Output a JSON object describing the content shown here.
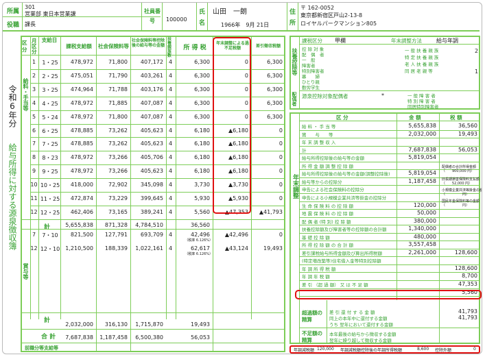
{
  "header": {
    "dept_label": "所属",
    "role_label": "役職",
    "dept_code": "301",
    "dept_name": "営業部 東日本営業課",
    "role": "課長",
    "emp_label": "社員番号",
    "emp_no": "100000",
    "name_label": "氏名",
    "name": "山田　一朗",
    "birth": "1966年　9月 21日",
    "addr_label": "住所",
    "zip": "〒 162-0052",
    "addr1": "東京都新宿区戸山2-13-8",
    "addr2": "ロイヤルパークマンション805"
  },
  "side_title": {
    "year": "令和6年分",
    "title": "給与所得に対する源泉徴収簿"
  },
  "columns": {
    "kubun": "区分",
    "month": "月区分",
    "payday": "支給日",
    "gross": "課税支給額",
    "social": "社会保険料等",
    "after_social": "社会保険料等控除後の給与等の金額",
    "dependents": "扶養親族数",
    "tax": "所 得 税",
    "adjust": "年末調整による過不足税額",
    "net": "差引徴収税額"
  },
  "salary_label": "給料・手当等",
  "bonus_label": "賞与等",
  "salary_rows": [
    {
      "m": "1",
      "d": "1・25",
      "gross": "478,972",
      "social": "71,800",
      "after": "407,172",
      "dep": "4",
      "tax": "6,300",
      "adj": "0",
      "net": "6,300"
    },
    {
      "m": "2",
      "d": "2・25",
      "gross": "475,051",
      "social": "71,790",
      "after": "403,261",
      "dep": "4",
      "tax": "6,300",
      "adj": "0",
      "net": "6,300"
    },
    {
      "m": "3",
      "d": "3・25",
      "gross": "474,964",
      "social": "71,788",
      "after": "403,176",
      "dep": "4",
      "tax": "6,300",
      "adj": "0",
      "net": "6,300"
    },
    {
      "m": "4",
      "d": "4・25",
      "gross": "478,972",
      "social": "71,885",
      "after": "407,087",
      "dep": "4",
      "tax": "6,300",
      "adj": "0",
      "net": "6,300"
    },
    {
      "m": "5",
      "d": "5・24",
      "gross": "478,972",
      "social": "71,800",
      "after": "407,087",
      "dep": "4",
      "tax": "6,300",
      "adj": "0",
      "net": "6,300"
    },
    {
      "m": "6",
      "d": "6・25",
      "gross": "478,885",
      "social": "73,262",
      "after": "405,623",
      "dep": "4",
      "tax": "6,180",
      "adj": "▲6,180",
      "net": "0"
    },
    {
      "m": "7",
      "d": "7・25",
      "gross": "478,885",
      "social": "73,262",
      "after": "405,623",
      "dep": "4",
      "tax": "6,180",
      "adj": "▲6,180",
      "net": "0"
    },
    {
      "m": "8",
      "d": "8・23",
      "gross": "478,972",
      "social": "73,266",
      "after": "405,706",
      "dep": "4",
      "tax": "6,180",
      "adj": "▲6,180",
      "net": "0"
    },
    {
      "m": "9",
      "d": "9・25",
      "gross": "478,972",
      "social": "73,266",
      "after": "405,623",
      "dep": "4",
      "tax": "6,180",
      "adj": "▲6,180",
      "net": "0"
    },
    {
      "m": "10",
      "d": "10・25",
      "gross": "418,000",
      "social": "72,902",
      "after": "345,098",
      "dep": "4",
      "tax": "3,730",
      "adj": "▲3,730",
      "net": "0"
    },
    {
      "m": "11",
      "d": "11・25",
      "gross": "472,874",
      "social": "73,229",
      "after": "399,645",
      "dep": "4",
      "tax": "5,930",
      "adj": "▲5,930",
      "net": "0"
    },
    {
      "m": "12",
      "d": "12・25",
      "gross": "462,406",
      "social": "73,165",
      "after": "389,241",
      "dep": "4",
      "tax": "5,560",
      "adj": "▲47,353",
      "net": "▲41,793"
    }
  ],
  "salary_total": {
    "label": "計",
    "gross": "5,655,838",
    "social": "871,328",
    "after": "4,784,510",
    "tax": "36,560"
  },
  "bonus_rows": [
    {
      "m": "7",
      "d": "7・10",
      "gross": "821,500",
      "social": "127,791",
      "after": "693,709",
      "dep": "4",
      "tax": "42,496",
      "rate": "（税率 6.126%）",
      "adj": "▲42,496",
      "net": "0"
    },
    {
      "m": "12",
      "d": "12・10",
      "gross": "1,210,500",
      "social": "188,339",
      "after": "1,022,161",
      "dep": "4",
      "tax": "62,617",
      "rate": "（税率 6.126%）",
      "adj": "▲43,124",
      "net": "19,493"
    }
  ],
  "bonus_total": {
    "label": "計",
    "gross": "2,032,000",
    "social": "316,130",
    "after": "1,715,870",
    "tax": "19,493"
  },
  "grand_total": {
    "label": "合 計",
    "gross": "7,687,838",
    "social": "1,187,458",
    "after": "6,500,380",
    "tax": "56,053"
  },
  "prev_job_label": "前職分等支給等",
  "right_top": {
    "kubun_label": "課税区分",
    "kubun_value": "甲欄",
    "method_label": "年末調整方法",
    "method_value": "給与年調",
    "dep_side": "扶養控除等",
    "items_left": [
      "控 除 対 象",
      "配　偶　者",
      "一　般",
      "障害者",
      "特別障害者",
      "寡　　婦",
      "ひとり親",
      "勤労学生"
    ],
    "items_right": [
      "一 般 扶 養 親 族",
      "特 定 扶 養 親 族",
      "老 人 扶 養 親 族",
      "同 居 老 親 等"
    ],
    "right_vals": [
      "2",
      "1"
    ],
    "spouse_label": "源泉控除対象配偶者",
    "spouse_mark": "*",
    "spouse_side": "配偶者",
    "spouse_items": [
      "一 般 障 害 者",
      "特 別 障 害 者",
      "同居特別障害者"
    ]
  },
  "year_end": {
    "side": "年末調整",
    "col_kubun": "区 分",
    "col_amount": "金 額",
    "col_tax": "税 額",
    "rows": [
      {
        "label": "給 料 ・ 手 当 等",
        "amount": "5,655,838",
        "tax": "36,560"
      },
      {
        "label": "賞　　与　　等",
        "amount": "2,032,000",
        "tax": "19,493"
      },
      {
        "label": "年 末 調 整 収 入",
        "amount": "",
        "tax": ""
      },
      {
        "label": "計",
        "amount": "7,687,838",
        "tax": "56,053"
      },
      {
        "label": "給与所得控除後の給与等の金額",
        "amount": "5,819,054",
        "tax": ""
      },
      {
        "label": "所 得 金 額 調 整 控 除 額",
        "amount": "",
        "tax": ""
      },
      {
        "label": "給与所得控除後の給与等の金額(調整控除後)",
        "amount": "5,819,054",
        "tax": ""
      },
      {
        "label": "給与等からの控除分",
        "amount": "1,187,458",
        "tax": ""
      },
      {
        "label": "申告による社会保険料の控除分",
        "amount": "",
        "tax": ""
      },
      {
        "label": "申告による小規模企業共済等掛金の控除分",
        "amount": "",
        "tax": ""
      },
      {
        "label": "生 命 保 険 料 の 控 除 額",
        "amount": "120,000",
        "tax": ""
      },
      {
        "label": "地 震 保 険 料 の 控 除 額",
        "amount": "50,000",
        "tax": ""
      },
      {
        "label": "配 偶 者 (特 別) 控 除 額",
        "amount": "380,000",
        "tax": ""
      },
      {
        "label": "扶養控除額及び障害者等の控除額の合計額",
        "amount": "1,340,000",
        "tax": ""
      },
      {
        "label": "基 礎 控 除 額",
        "amount": "480,000",
        "tax": ""
      },
      {
        "label": "所 得 控 除 額 の 合 計 額",
        "amount": "3,557,458",
        "tax": ""
      },
      {
        "label": "差引課税給与所得金額及び算出所得税額",
        "amount": "2,261,000",
        "tax": "128,600"
      },
      {
        "label": "(特定増改築等)住宅借入金等特別控除額",
        "amount": "",
        "tax": ""
      },
      {
        "label": "年 調 所 得 税 額",
        "amount": "",
        "tax": "128,600"
      },
      {
        "label": "年 調 年 税 額",
        "amount": "",
        "tax": "8,700"
      },
      {
        "label": "差 引 （超 過 額） 又 は 不 足 額",
        "amount": "",
        "tax": "47,353"
      },
      {
        "label": "",
        "amount": "",
        "tax": "5,560"
      }
    ],
    "side_notes": [
      {
        "label": "配偶者の合計所得金額",
        "value": "（　　900,000 円）"
      },
      {
        "label": "旧長期損害保険料支払額",
        "value": "（　　52,000 円）"
      },
      {
        "label": "小規模企業共済等掛金の額",
        "value": "（　　　　　円）"
      },
      {
        "label": "国民年金保険料等の金額",
        "value": "（　　　　　円）"
      }
    ],
    "excess_label": "超過額の精算",
    "excess_rows": [
      {
        "label": "差 引 還 付 す る 金 額",
        "tax": "41,793"
      },
      {
        "label": "同上の本年中に還付する金額",
        "tax": "41,793"
      },
      {
        "label": "うち 翌年において還付する金額",
        "tax": ""
      }
    ],
    "shortage_label": "不足額の精算",
    "shortage_rows": [
      {
        "label": "本年最後の給与から徴収する金額",
        "tax": ""
      },
      {
        "label": "翌年に繰り越して徴収する金額",
        "tax": ""
      }
    ]
  },
  "footer": {
    "reduction_label": "年調減税額",
    "reduction_value": "120,000",
    "after_label": "年調減税額控除後の年調所得税額",
    "after_value": "8,600",
    "excess_label": "控除外額",
    "excess_value": "0"
  },
  "colors": {
    "green": "#3aa335",
    "border": "#7ccd57",
    "red": "#e01010"
  }
}
